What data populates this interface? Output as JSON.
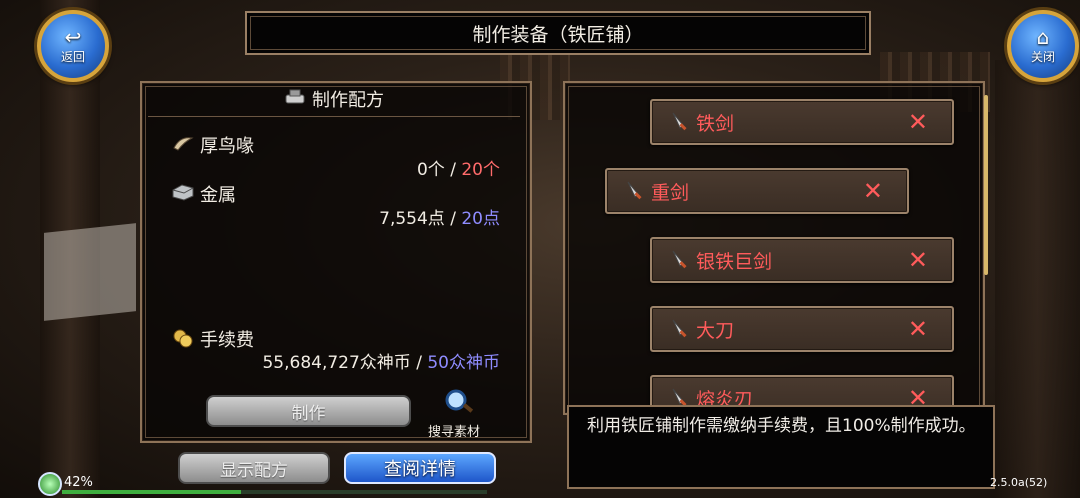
{
  "top": {
    "back_label": "返回",
    "close_label": "关闭",
    "title": "制作装备（铁匠铺）"
  },
  "recipe": {
    "heading": "制作配方",
    "materials": [
      {
        "name": "厚鸟喙",
        "have": "0个",
        "sep": " / ",
        "need": "20个",
        "need_color": "#ff6b6b"
      },
      {
        "name": "金属",
        "have": "7,554点",
        "sep": " / ",
        "need": "20点",
        "need_color": "#8f8cff"
      }
    ],
    "fee": {
      "label": "手续费",
      "have": "55,684,727众神币",
      "sep": " / ",
      "need": "50众神币",
      "need_color": "#8f8cff"
    },
    "craft_label": "制作",
    "search_label": "搜寻素材"
  },
  "bottom": {
    "show_recipe_label": "显示配方",
    "details_label": "查阅详情",
    "battery": "42%",
    "battery_level": 0.42,
    "version": "2.5.0a(52)"
  },
  "items": [
    {
      "name": "铁剑"
    },
    {
      "name": "重剑"
    },
    {
      "name": "银铁巨剑"
    },
    {
      "name": "大刀"
    },
    {
      "name": "熔炎刃"
    }
  ],
  "info": {
    "text": "利用铁匠铺制作需缴纳手续费，且100%制作成功。"
  }
}
